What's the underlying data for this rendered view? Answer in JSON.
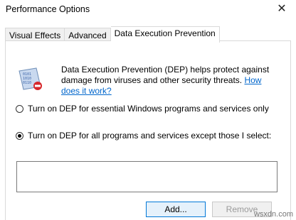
{
  "window": {
    "title": "Performance Options",
    "close_glyph": "✕"
  },
  "tabs": [
    {
      "label": "Visual Effects",
      "active": false
    },
    {
      "label": "Advanced",
      "active": false
    },
    {
      "label": "Data Execution Prevention",
      "active": true
    }
  ],
  "dep": {
    "icon": "dep-shield-icon",
    "description": "Data Execution Prevention (DEP) helps protect against damage from viruses and other security threats.",
    "link_text": "How does it work?",
    "link_color": "#0066cc"
  },
  "options": [
    {
      "label": "Turn on DEP for essential Windows programs and services only",
      "checked": false
    },
    {
      "label": "Turn on DEP for all programs and services except those I select:",
      "checked": true
    }
  ],
  "buttons": {
    "add_label": "Add...",
    "remove_label": "Remove"
  },
  "watermark": "wsxdn.com"
}
